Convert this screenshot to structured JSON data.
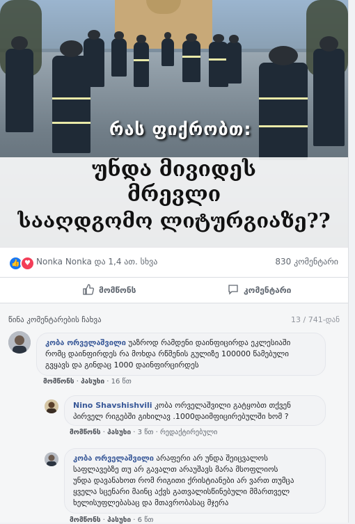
{
  "hero": {
    "caption_top": "რას ფიქრობთ:",
    "caption_line1": "უნდა მივიდეს",
    "caption_line2": "მრევლი",
    "caption_line3": "სააღდგომო ლიტურგიაზე??"
  },
  "reactions": {
    "names": "Nonka Nonka და 1,4 ათ. სხვა",
    "comment_count": "830 კომენტარი"
  },
  "actions": {
    "like_label": "მომწონს",
    "comment_label": "კომენტარი"
  },
  "comments_section": {
    "previous_link": "წინა კომენტარების ჩახვა",
    "counter": "13 / 741-დან"
  },
  "comments": [
    {
      "author": "კობა ორველაშვილი",
      "lines": [
        "უაზროდ რამდენი დაინფიცირდა ეკლესიაში",
        "რომც დაინფირდეს რა მოხდა რწმენის გულიზე 100000 წამებული",
        "გვყავს და გინდაც 1000 დაინფირცირდეს"
      ],
      "like_label": "მომწონს",
      "reply_label": "პასუხი",
      "time": "16 წთ"
    },
    {
      "author": "Nino Shavshishvili",
      "lines": [
        "კობა ორველაშვილი გატყობთ თქვენ",
        "პირველ რიგებში გიხილავ .1000დაიმფიცირებულში ხომ ?"
      ],
      "like_label": "მომწონს",
      "reply_label": "პასუხი",
      "time": "3 წთ",
      "edited_label": "რედაქტირებული"
    },
    {
      "author": "კობა ორველაშვილი",
      "lines": [
        "არაფერი არ უნდა შეიცვალოს",
        "საფლავებზე თუ არ გავალთ არაუშავს მარა მსოფლიოს",
        "უნდა დავანახოთ რომ რიგითი ქრისტიანები არ ვართ თუმცა",
        "ყველა სცენარი მაინც აქვს გათვალისწინებული მმართველ",
        "ხელისუფლებასაც და მთავრობასაც მჯერა"
      ],
      "like_label": "მომწონს",
      "reply_label": "პასუხი",
      "time": "6 წთ"
    }
  ],
  "colors": {
    "link_blue": "#385898",
    "like_blue": "#1877f2",
    "love_red": "#f33e58"
  }
}
